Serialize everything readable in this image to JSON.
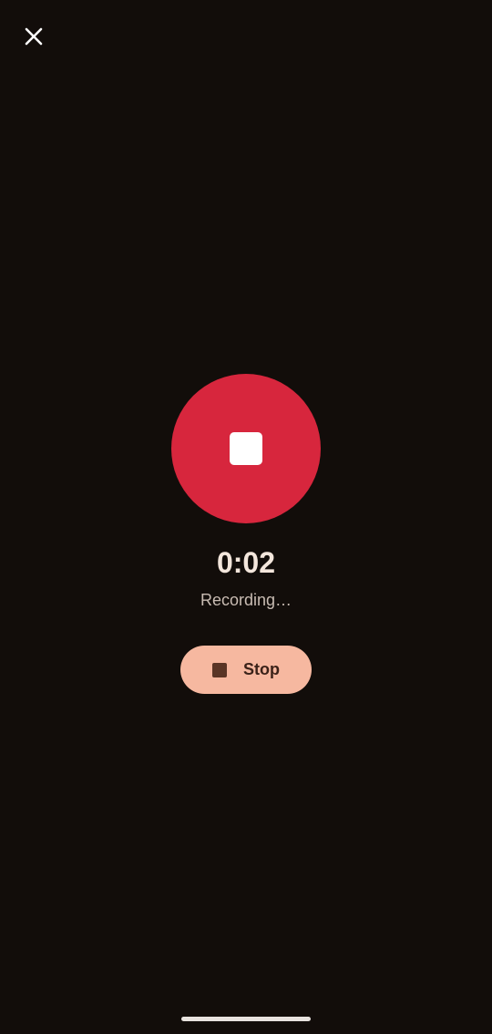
{
  "timer": {
    "elapsed": "0:02",
    "status": "Recording…"
  },
  "actions": {
    "stop_label": "Stop"
  },
  "icons": {
    "close": "close-icon",
    "record_stop": "stop-square-icon",
    "pill_stop": "stop-icon"
  },
  "colors": {
    "background": "#120d0a",
    "record_red": "#d7263d",
    "pill_background": "#f6b8a0",
    "pill_text": "#3b2219"
  }
}
